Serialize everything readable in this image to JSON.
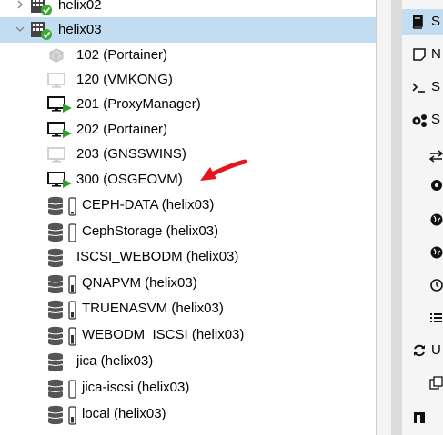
{
  "tree": {
    "nodes": [
      {
        "label": "helix02",
        "type": "node",
        "icon": "server-online-icon",
        "twisty": "chevron-right"
      },
      {
        "label": "helix03",
        "type": "node",
        "icon": "server-online-icon",
        "twisty": "chevron-down",
        "selected": true
      },
      {
        "label": "102 (Portainer)",
        "type": "container",
        "icon": "container-icon",
        "status": "stopped"
      },
      {
        "label": "120 (VMKONG)",
        "type": "vm",
        "icon": "vm-monitor-icon",
        "status": "stopped"
      },
      {
        "label": "201 (ProxyManager)",
        "type": "vm",
        "icon": "vm-monitor-icon",
        "status": "running"
      },
      {
        "label": "202 (Portainer)",
        "type": "vm",
        "icon": "vm-monitor-icon",
        "status": "running"
      },
      {
        "label": "203 (GNSSWINS)",
        "type": "vm",
        "icon": "vm-monitor-icon",
        "status": "stopped"
      },
      {
        "label": "300 (OSGEOVM)",
        "type": "vm",
        "icon": "vm-monitor-icon",
        "status": "running"
      },
      {
        "label": "CEPH-DATA (helix03)",
        "type": "storage",
        "icon": "storage-database-icon",
        "gauge": true
      },
      {
        "label": "CephStorage (helix03)",
        "type": "storage",
        "icon": "storage-database-icon",
        "gauge": true
      },
      {
        "label": "ISCSI_WEBODM (helix03)",
        "type": "storage",
        "icon": "storage-database-icon",
        "gauge": false
      },
      {
        "label": "QNAPVM (helix03)",
        "type": "storage",
        "icon": "storage-database-icon",
        "gauge": true
      },
      {
        "label": "TRUENASVM (helix03)",
        "type": "storage",
        "icon": "storage-database-icon",
        "gauge": true
      },
      {
        "label": "WEBODM_ISCSI (helix03)",
        "type": "storage",
        "icon": "storage-database-icon",
        "gauge": true
      },
      {
        "label": "jica (helix03)",
        "type": "storage",
        "icon": "storage-database-icon",
        "gauge": false
      },
      {
        "label": "jica-iscsi (helix03)",
        "type": "storage",
        "icon": "storage-database-icon",
        "gauge": true
      },
      {
        "label": "local (helix03)",
        "type": "storage",
        "icon": "storage-database-icon",
        "gauge": true
      }
    ]
  },
  "annotation": {
    "icon": "red-arrow-icon",
    "color": "#e8141b"
  },
  "side_panel": {
    "items": [
      {
        "icon": "book-icon",
        "text": "S",
        "active": true
      },
      {
        "icon": "note-icon",
        "text": "N"
      },
      {
        "icon": "terminal-icon",
        "text": "S"
      },
      {
        "icon": "gears-icon",
        "text": "S"
      },
      {
        "icon": "arrows-icon",
        "text": ""
      },
      {
        "icon": "cog-icon",
        "text": ""
      },
      {
        "icon": "globe-icon",
        "text": ""
      },
      {
        "icon": "globe-icon",
        "text": ""
      },
      {
        "icon": "clock-icon",
        "text": ""
      },
      {
        "icon": "list-icon",
        "text": ""
      },
      {
        "icon": "refresh-icon",
        "text": "U"
      },
      {
        "icon": "copy-icon",
        "text": ""
      },
      {
        "icon": "square-icon",
        "text": ""
      }
    ]
  },
  "colors": {
    "selected_bg": "#c2ddf2",
    "running_green": "#2ca02c",
    "ok_badge": "#3aaa35"
  }
}
